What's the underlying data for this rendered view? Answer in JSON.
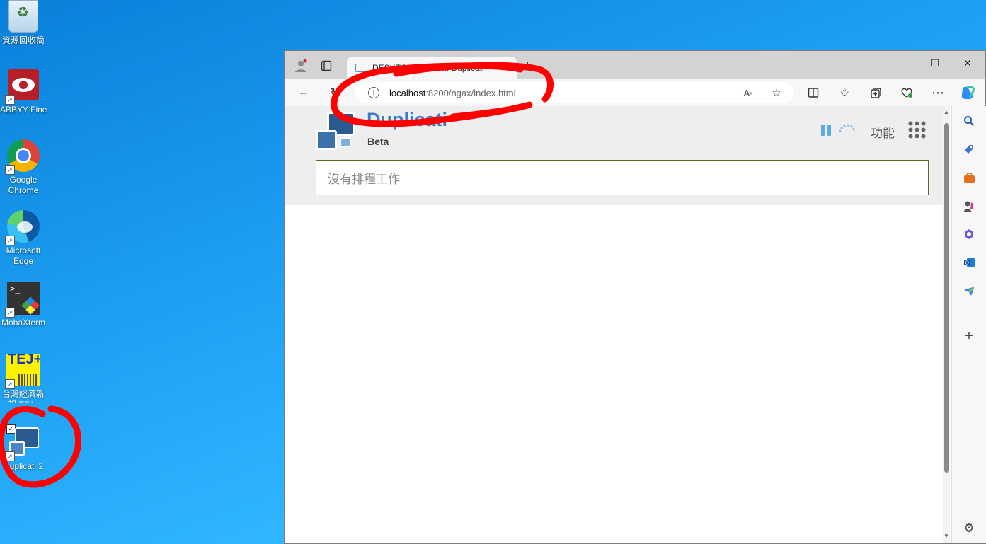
{
  "desktop": {
    "icons": [
      {
        "label": "資源回收筒",
        "icon": "recycle-bin-icon"
      },
      {
        "label": "ABBYY FineRead...",
        "icon": "abbyy-icon"
      },
      {
        "label": "Google Chrome",
        "icon": "chrome-icon"
      },
      {
        "label": "Microsoft Edge",
        "icon": "edge-icon"
      },
      {
        "label": "MobaXterm",
        "icon": "mobaxterm-icon"
      },
      {
        "label": "台灣經濟新報 TEJ+",
        "icon": "tej-icon",
        "logo_text": "TEJ+"
      },
      {
        "label": "Duplicati 2",
        "icon": "duplicati-icon"
      }
    ]
  },
  "browser": {
    "tab_title": "DESKTOP-KHF4P... Duplicati",
    "address_host": "localhost",
    "address_path": ":8200/ngax/index.html",
    "page": {
      "app_name": "Duplicati",
      "app_subtitle": "Beta",
      "menu_label": "功能",
      "schedule_text": "沒有排程工作"
    }
  },
  "annotation_color": "#ff0000"
}
